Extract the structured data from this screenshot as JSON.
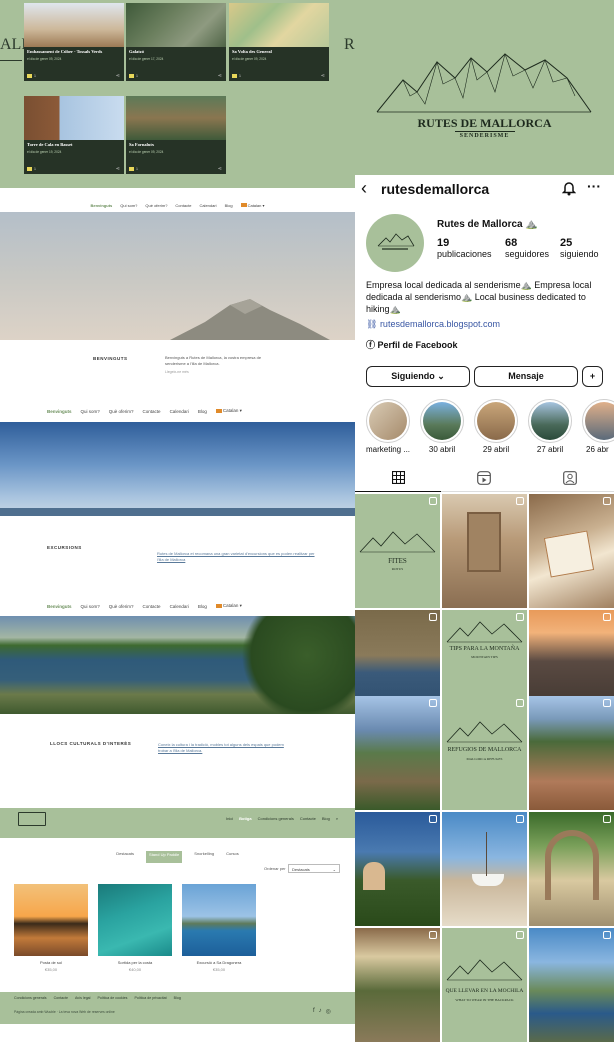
{
  "blog": {
    "edge_left": "ALL",
    "edge_right": "R",
    "cards": [
      {
        "title": "Embassament de Cúber - Tossals Verds",
        "date": "el dia de gener 09, 2024",
        "count": "1"
      },
      {
        "title": "Galatzó",
        "date": "el dia de gener 17, 2024",
        "count": "1"
      },
      {
        "title": "Sa Volta des General",
        "date": "el dia de gener 09, 2024",
        "count": "1"
      },
      {
        "title": "Torre de Cala en Basset",
        "date": "el dia de gener 19, 2024",
        "count": "1"
      },
      {
        "title": "Sa Fornalutx",
        "date": "el dia de gener 09, 2024",
        "count": "1"
      }
    ]
  },
  "site": {
    "nav_small": [
      "Benvinguts",
      "Qui som?",
      "Què oferim?",
      "Contacte",
      "Calendari",
      "Blog",
      "Catalan ▾"
    ],
    "nav": [
      "Benvinguts",
      "Qui som?",
      "Què oferim?",
      "Contacte",
      "Calendari",
      "Blog",
      "Catalan ▾"
    ],
    "section1": {
      "heading": "BENVINGUTS",
      "text": "Benvinguts a Rutes de Mallorca, la vostra empresa de senderisme a l'illa de Mallorca.",
      "more": "Llegeix-ne més"
    },
    "section2": {
      "heading": "EXCURSIONS",
      "text": "Rutes de Mallorca et recomana una gran varietat d'excursions que es poden realitzar per l'illa de Mallorca"
    },
    "section3": {
      "heading": "LLOCS CULTURALS D'INTERÈS",
      "text": "Coneix la cultura i la tradició, mobles tot alguns dels espais que podem trobar a l'illa de Mallorca."
    }
  },
  "shop": {
    "nav": [
      "Inici",
      "Botiga",
      "Condicions generals",
      "Contacte",
      "Blog"
    ],
    "tabs": [
      "Destacats",
      "Stand Up Paddle",
      "Snorkelling",
      "Cursos"
    ],
    "sort_label": "Ordenar per",
    "sort_value": "Destacats",
    "products": [
      {
        "title": "Posta de sol",
        "price": "€35,00"
      },
      {
        "title": "Sortida per la costa",
        "price": "€40,00"
      },
      {
        "title": "Excursió a Sa Dragonera",
        "price": "€35,00"
      }
    ],
    "footer_links": [
      "Condicions generals",
      "Contacte",
      "Avís legal",
      "Política de cookies",
      "Política de privacitat",
      "Blog"
    ],
    "footer_note": "Pàgina creada amb Wuuble · La teva nova Web de reserves online"
  },
  "instagram": {
    "brand_title": "RUTES DE MALLORCA",
    "brand_sub": "SENDERISME",
    "username": "rutesdemallorca",
    "profile_name": "Rutes de Mallorca ⛰️",
    "stats": [
      {
        "value": "19",
        "label": "publicaciones"
      },
      {
        "value": "68",
        "label": "seguidores"
      },
      {
        "value": "25",
        "label": "siguiendo"
      }
    ],
    "bio": "Empresa local dedicada al senderisme⛰️ Empresa local dedicada al senderismo⛰️ Local business dedicated to hiking⛰️",
    "url": "rutesdemallorca.blogspot.com",
    "facebook": "Perfil de Facebook",
    "buttons": {
      "follow": "Siguiendo ⌄",
      "message": "Mensaje"
    },
    "highlights": [
      "marketing ...",
      "30 abril",
      "29 abril",
      "27 abril",
      "26 abr"
    ],
    "grid_titles": {
      "fites": "FITES",
      "fites_sub": "ROTUS",
      "tips": "TIPS PARA LA MONTAÑA",
      "tips_sub": "MOUNTAIN TIPS",
      "refugios": "REFUGIOS DE MALLORCA",
      "refugios_sub": "MALLORCA REFUGES",
      "mochila": "QUE LLEVAR EN LA MOCHILA",
      "mochila_sub": "WHAT TO WEAR IN THE BACKPACK"
    }
  }
}
